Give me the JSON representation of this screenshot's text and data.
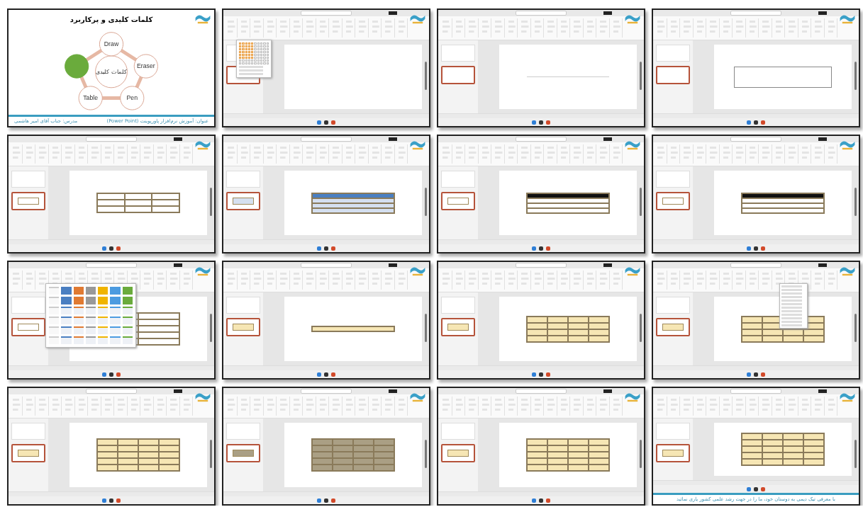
{
  "thumbnails": [
    {
      "kind": "title_slide",
      "title": "کلمات کلیدی و پرکاربرد",
      "center_label": "کلمات کلیدی",
      "circles": [
        {
          "label": "Draw",
          "selected": false
        },
        {
          "label": "Eraser",
          "selected": false
        },
        {
          "label": "Pen",
          "selected": false
        },
        {
          "label": "Table",
          "selected": false
        },
        {
          "selected": true
        }
      ],
      "course": "عنوان: آموزش نرم‌افزار پاورپوینت (Power Point)",
      "teacher": "مدرس: جناب آقای امیر هاشمی"
    },
    {
      "kind": "app",
      "overlay": {
        "kind": "size_menu"
      }
    },
    {
      "kind": "app",
      "table": {
        "kind": "line"
      }
    },
    {
      "kind": "app",
      "table": {
        "kind": "outline"
      }
    },
    {
      "kind": "app",
      "table": {
        "kind": "grid3",
        "color": "#ffffff"
      }
    },
    {
      "kind": "app",
      "table": {
        "kind": "blueband",
        "color": "#d5e0f0"
      }
    },
    {
      "kind": "app",
      "table": {
        "kind": "blackband",
        "color": "#ffffff"
      }
    },
    {
      "kind": "app",
      "table": {
        "kind": "blackband",
        "color": "#ffffff"
      }
    },
    {
      "kind": "app",
      "overlay": {
        "kind": "gallery"
      },
      "table": {
        "kind": "grid2",
        "color": "#ffffff"
      }
    },
    {
      "kind": "app",
      "table": {
        "kind": "single",
        "color": "#f6e6b4"
      }
    },
    {
      "kind": "app",
      "table": {
        "kind": "grid4",
        "color": "#f6e6b4"
      }
    },
    {
      "kind": "app",
      "overlay": {
        "kind": "dropdown"
      },
      "table": {
        "kind": "grid4",
        "color": "#f6e6b4"
      }
    },
    {
      "kind": "app",
      "table": {
        "kind": "grid5",
        "color": "#f6e6b4"
      }
    },
    {
      "kind": "app",
      "table": {
        "kind": "grid5",
        "color": "#aa9f84"
      }
    },
    {
      "kind": "app",
      "table": {
        "kind": "grid5",
        "color": "#f6e6b4"
      }
    },
    {
      "kind": "app",
      "table": {
        "kind": "grid5",
        "color": "#f6e6b4"
      },
      "caption": "با معرفی تیک دیمی به دوستان خود، ما را در جهت رشد علمی کشور یاری نمائید"
    }
  ]
}
